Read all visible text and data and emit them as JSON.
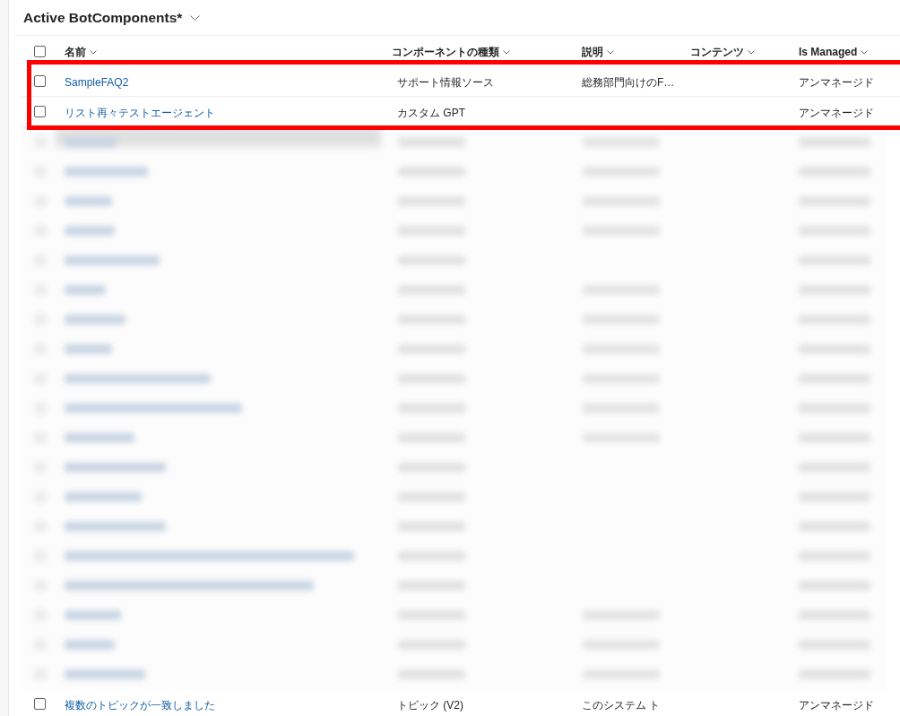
{
  "view": {
    "title": "Active BotComponents*"
  },
  "table": {
    "select_all": {
      "checked": false
    },
    "columns": [
      {
        "label": "名前"
      },
      {
        "label": "コンポーネントの種類"
      },
      {
        "label": "説明"
      },
      {
        "label": "コンテンツ"
      },
      {
        "label": "Is Managed"
      }
    ],
    "rows": [
      {
        "kind": "record",
        "checked": false,
        "highlighted": true,
        "name": "SampleFAQ2",
        "component_type": "サポート情報ソース",
        "description": "総務部門向けのF…",
        "managed": "アンマネージド"
      },
      {
        "kind": "record",
        "checked": false,
        "highlighted": true,
        "name": "リスト再々テストエージェント",
        "component_type": "カスタム GPT",
        "managed": "アンマネージド"
      },
      {
        "kind": "blurred"
      },
      {
        "kind": "blurred"
      },
      {
        "kind": "blurred"
      },
      {
        "kind": "blurred"
      },
      {
        "kind": "blurred"
      },
      {
        "kind": "blurred"
      },
      {
        "kind": "blurred"
      },
      {
        "kind": "blurred"
      },
      {
        "kind": "blurred"
      },
      {
        "kind": "blurred"
      },
      {
        "kind": "blurred"
      },
      {
        "kind": "blurred"
      },
      {
        "kind": "blurred"
      },
      {
        "kind": "blurred"
      },
      {
        "kind": "blurred"
      },
      {
        "kind": "blurred"
      },
      {
        "kind": "blurred"
      },
      {
        "kind": "blurred"
      },
      {
        "kind": "blurred"
      },
      {
        "kind": "record",
        "checked": false,
        "highlighted": false,
        "name": "複数のトピックが一致しました",
        "component_type": "トピック (V2)",
        "description": "このシステム ト",
        "managed": "アンマネージド"
      }
    ]
  }
}
